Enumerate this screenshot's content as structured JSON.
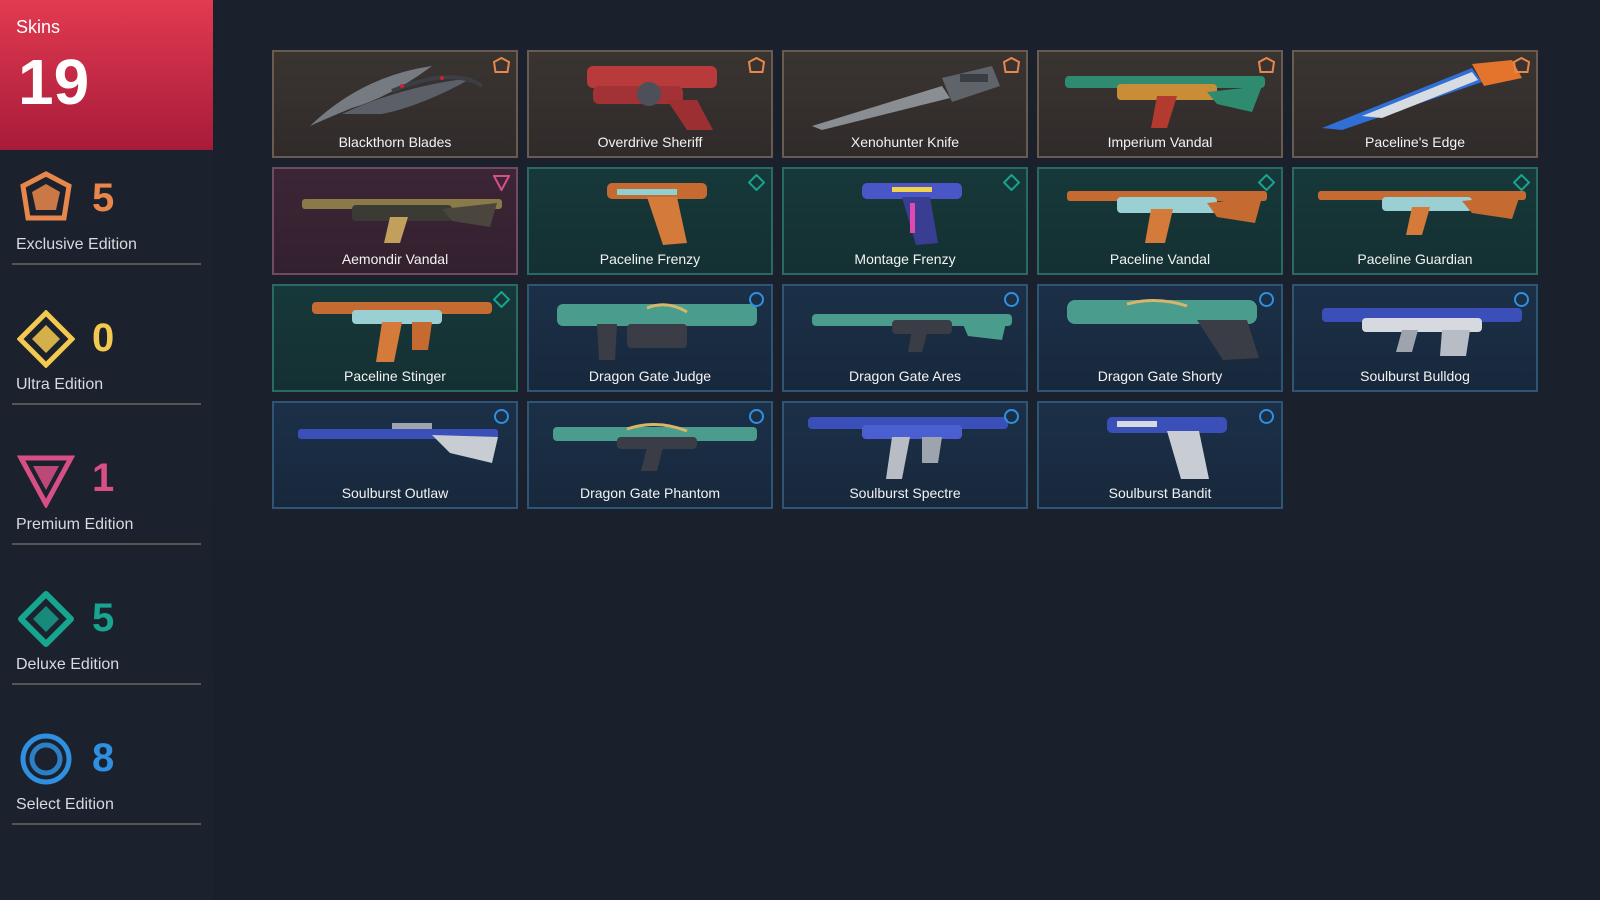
{
  "summary": {
    "label": "Skins",
    "count": "19"
  },
  "tiers": [
    {
      "key": "exclusive",
      "label": "Exclusive Edition",
      "count": "5",
      "color": "#e8874b",
      "icon": "exclusive-tier-icon"
    },
    {
      "key": "ultra",
      "label": "Ultra Edition",
      "count": "0",
      "color": "#f3c94f",
      "icon": "ultra-tier-icon"
    },
    {
      "key": "premium",
      "label": "Premium Edition",
      "count": "1",
      "color": "#d84f86",
      "icon": "premium-tier-icon"
    },
    {
      "key": "deluxe",
      "label": "Deluxe Edition",
      "count": "5",
      "color": "#17a58f",
      "icon": "deluxe-tier-icon"
    },
    {
      "key": "select",
      "label": "Select Edition",
      "count": "8",
      "color": "#2f8fe0",
      "icon": "select-tier-icon"
    }
  ],
  "skins": [
    {
      "name": "Blackthorn Blades",
      "tier": "exclusive"
    },
    {
      "name": "Overdrive Sheriff",
      "tier": "exclusive"
    },
    {
      "name": "Xenohunter Knife",
      "tier": "exclusive"
    },
    {
      "name": "Imperium Vandal",
      "tier": "exclusive"
    },
    {
      "name": "Paceline's Edge",
      "tier": "exclusive"
    },
    {
      "name": "Aemondir Vandal",
      "tier": "premium"
    },
    {
      "name": "Paceline Frenzy",
      "tier": "deluxe"
    },
    {
      "name": "Montage Frenzy",
      "tier": "deluxe"
    },
    {
      "name": "Paceline Vandal",
      "tier": "deluxe"
    },
    {
      "name": "Paceline Guardian",
      "tier": "deluxe"
    },
    {
      "name": "Paceline Stinger",
      "tier": "deluxe"
    },
    {
      "name": "Dragon Gate Judge",
      "tier": "select"
    },
    {
      "name": "Dragon Gate Ares",
      "tier": "select"
    },
    {
      "name": "Dragon Gate Shorty",
      "tier": "select"
    },
    {
      "name": "Soulburst Bulldog",
      "tier": "select"
    },
    {
      "name": "Soulburst Outlaw",
      "tier": "select"
    },
    {
      "name": "Dragon Gate Phantom",
      "tier": "select"
    },
    {
      "name": "Soulburst Spectre",
      "tier": "select"
    },
    {
      "name": "Soulburst Bandit",
      "tier": "select"
    }
  ]
}
